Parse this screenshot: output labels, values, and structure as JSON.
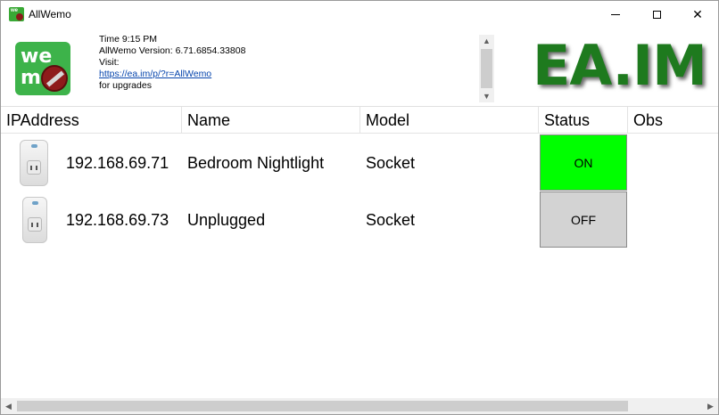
{
  "window": {
    "title": "AllWemo",
    "minimize_icon": "minimize-icon",
    "maximize_icon": "maximize-icon",
    "close_icon": "close-icon",
    "close_glyph": "✕"
  },
  "header": {
    "logo_top": "we",
    "logo_bottom": "mo",
    "time_line": "Time 9:15 PM",
    "version_line": "AllWemo Version: 6.71.6854.33808",
    "visit_line": "Visit:",
    "link": "https://ea.im/p/?r=AllWemo",
    "upgrade_line": "for upgrades",
    "brand": "EA.IM",
    "scroll_up": "▲",
    "scroll_down": "▼"
  },
  "table": {
    "columns": [
      "IPAddress",
      "Name",
      "Model",
      "Status",
      "Obs"
    ],
    "rows": [
      {
        "ip": "192.168.69.71",
        "name": "Bedroom Nightlight",
        "model": "Socket",
        "status": "ON",
        "status_color": "#00ff00",
        "obs": ""
      },
      {
        "ip": "192.168.69.73",
        "name": "Unplugged",
        "model": "Socket",
        "status": "OFF",
        "status_color": "#d3d3d3",
        "obs": ""
      }
    ]
  },
  "hscroll": {
    "left_arrow": "◀",
    "right_arrow": "▶"
  }
}
